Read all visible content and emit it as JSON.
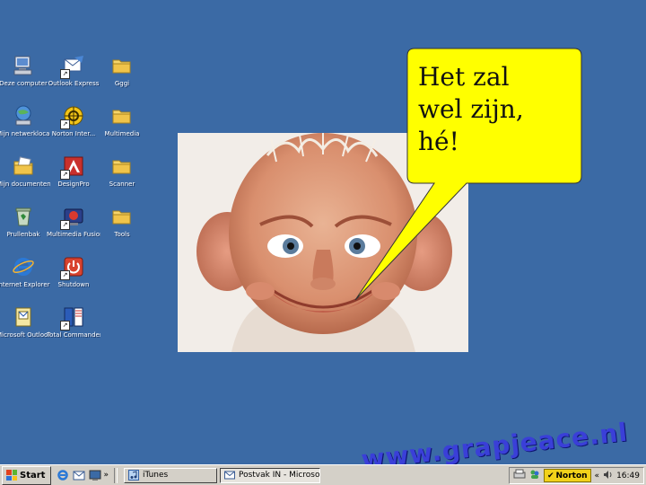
{
  "desktop": {
    "background": "#3b6aa5",
    "icons": [
      {
        "label": "Deze computer",
        "icon": "my-computer"
      },
      {
        "label": "Outlook Express",
        "icon": "outlook-express"
      },
      {
        "label": "Gggi",
        "icon": "folder"
      },
      {
        "label": "Mijn netwerkloca...",
        "icon": "network-places"
      },
      {
        "label": "Norton Inter...",
        "icon": "norton-internet-security"
      },
      {
        "label": "Multimedia",
        "icon": "folder"
      },
      {
        "label": "Mijn documenten",
        "icon": "my-documents"
      },
      {
        "label": "DesignPro",
        "icon": "designpro"
      },
      {
        "label": "Scanner",
        "icon": "folder"
      },
      {
        "label": "Prullenbak",
        "icon": "recycle-bin"
      },
      {
        "label": "Multimedia Fusion D...",
        "icon": "multimedia-fusion"
      },
      {
        "label": "Tools",
        "icon": "folder"
      },
      {
        "label": "Internet Explorer",
        "icon": "internet-explorer"
      },
      {
        "label": "Shutdown",
        "icon": "shutdown"
      },
      {
        "label": "Microsoft Outlook",
        "icon": "microsoft-outlook"
      },
      {
        "label": "Total Commander",
        "icon": "total-commander"
      }
    ]
  },
  "speech_bubble": {
    "lines": [
      "Het zal",
      "wel zijn,",
      "hé!"
    ]
  },
  "watermark": {
    "text": "www.grapjeace.nl"
  },
  "taskbar": {
    "start_label": "Start",
    "chevron": "»",
    "tasks": [
      {
        "label": "iTunes",
        "active": false
      },
      {
        "label": "Postvak IN - Microsoft O...",
        "active": true
      }
    ],
    "tray": {
      "norton_label": "Norton",
      "tray_chevron": "«",
      "clock": "16:49"
    }
  }
}
